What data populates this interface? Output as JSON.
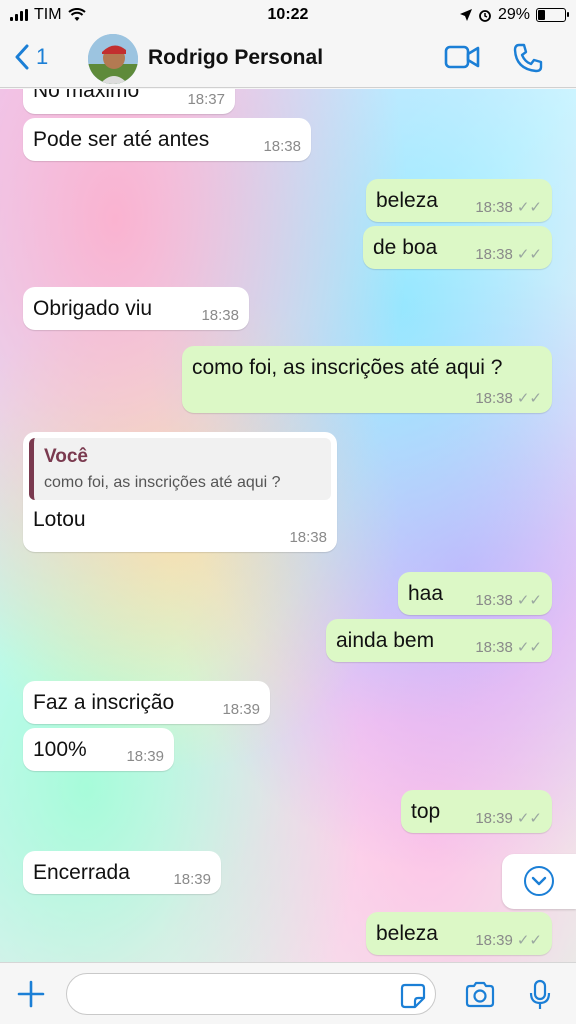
{
  "status_bar": {
    "carrier": "TIM",
    "time": "10:22",
    "battery": "29%"
  },
  "header": {
    "back_count": "1",
    "contact_name": "Rodrigo Personal"
  },
  "messages": [
    {
      "dir": "in",
      "text": "No máximo",
      "time": "18:37"
    },
    {
      "dir": "in",
      "text": "Pode ser até antes",
      "time": "18:38"
    },
    {
      "dir": "out",
      "text": "beleza",
      "time": "18:38"
    },
    {
      "dir": "out",
      "text": "de boa",
      "time": "18:38"
    },
    {
      "dir": "in",
      "text": "Obrigado viu",
      "time": "18:38"
    },
    {
      "dir": "out",
      "text": "como foi, as inscrições até aqui ?",
      "time": "18:38"
    },
    {
      "dir": "in",
      "text": "Lotou",
      "time": "18:38",
      "reply": {
        "author": "Você",
        "text": "como foi, as inscrições até aqui ?"
      }
    },
    {
      "dir": "out",
      "text": "haa",
      "time": "18:38"
    },
    {
      "dir": "out",
      "text": "ainda bem",
      "time": "18:38"
    },
    {
      "dir": "in",
      "text": "Faz a inscrição",
      "time": "18:39"
    },
    {
      "dir": "in",
      "text": "100%",
      "time": "18:39"
    },
    {
      "dir": "out",
      "text": "top",
      "time": "18:39"
    },
    {
      "dir": "in",
      "text": "Encerrada",
      "time": "18:39"
    },
    {
      "dir": "out",
      "text": "beleza",
      "time": "18:39"
    }
  ],
  "colors": {
    "accent": "#1b7fd6",
    "outgoing_bubble": "#dcf8c6",
    "incoming_bubble": "#ffffff",
    "reply_accent": "#7a3a4f"
  }
}
